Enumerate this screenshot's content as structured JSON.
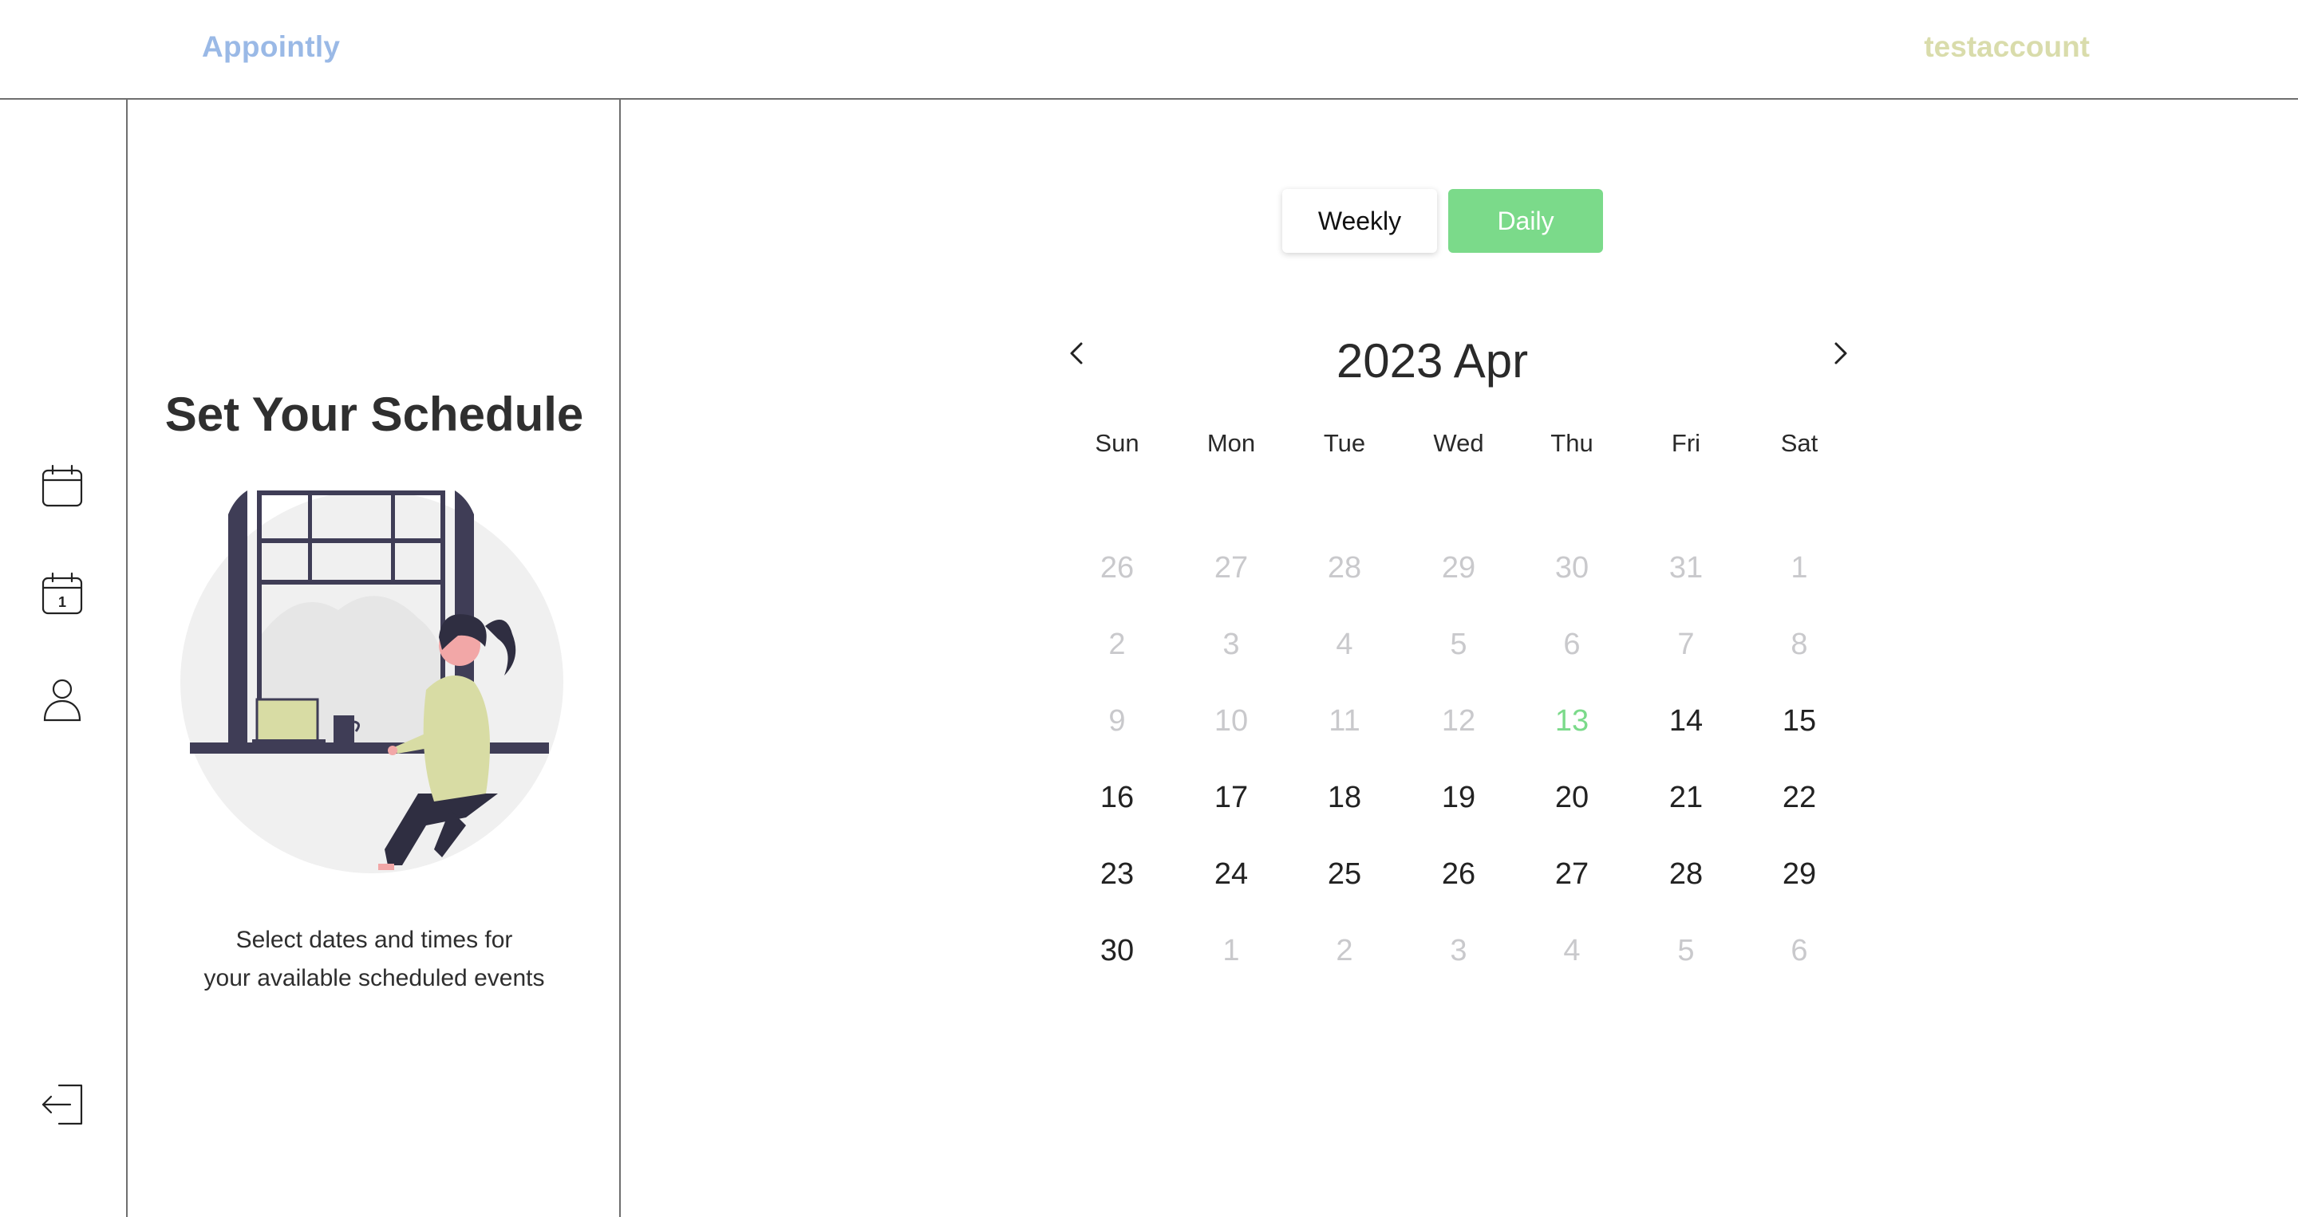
{
  "header": {
    "brand": "Appointly",
    "account": "testaccount"
  },
  "rail": {
    "icons": [
      "calendar-icon",
      "calendar-day-icon",
      "profile-icon",
      "logout-icon"
    ]
  },
  "panel": {
    "title": "Set Your Schedule",
    "description_line1": "Select dates and times for",
    "description_line2": "your available scheduled events"
  },
  "view_toggle": {
    "weekly_label": "Weekly",
    "daily_label": "Daily",
    "active": "Daily"
  },
  "calendar": {
    "month_title": "2023 Apr",
    "weekdays": [
      "Sun",
      "Mon",
      "Tue",
      "Wed",
      "Thu",
      "Fri",
      "Sat"
    ],
    "weeks": [
      [
        "26",
        "27",
        "28",
        "29",
        "30",
        "31",
        "1"
      ],
      [
        "2",
        "3",
        "4",
        "5",
        "6",
        "7",
        "8"
      ],
      [
        "9",
        "10",
        "11",
        "12",
        "13",
        "14",
        "15"
      ],
      [
        "16",
        "17",
        "18",
        "19",
        "20",
        "21",
        "22"
      ],
      [
        "23",
        "24",
        "25",
        "26",
        "27",
        "28",
        "29"
      ],
      [
        "30",
        "1",
        "2",
        "3",
        "4",
        "5",
        "6"
      ]
    ],
    "muted": [
      [
        true,
        true,
        true,
        true,
        true,
        true,
        true
      ],
      [
        true,
        true,
        true,
        true,
        true,
        true,
        true
      ],
      [
        true,
        true,
        true,
        true,
        false,
        false,
        false
      ],
      [
        false,
        false,
        false,
        false,
        false,
        false,
        false
      ],
      [
        false,
        false,
        false,
        false,
        false,
        false,
        false
      ],
      [
        false,
        true,
        true,
        true,
        true,
        true,
        true
      ]
    ],
    "today": "13"
  },
  "colors": {
    "brand": "#9ab9e6",
    "account": "#d9dcab",
    "accent": "#7bda8a",
    "muted": "#c9c9cc"
  }
}
